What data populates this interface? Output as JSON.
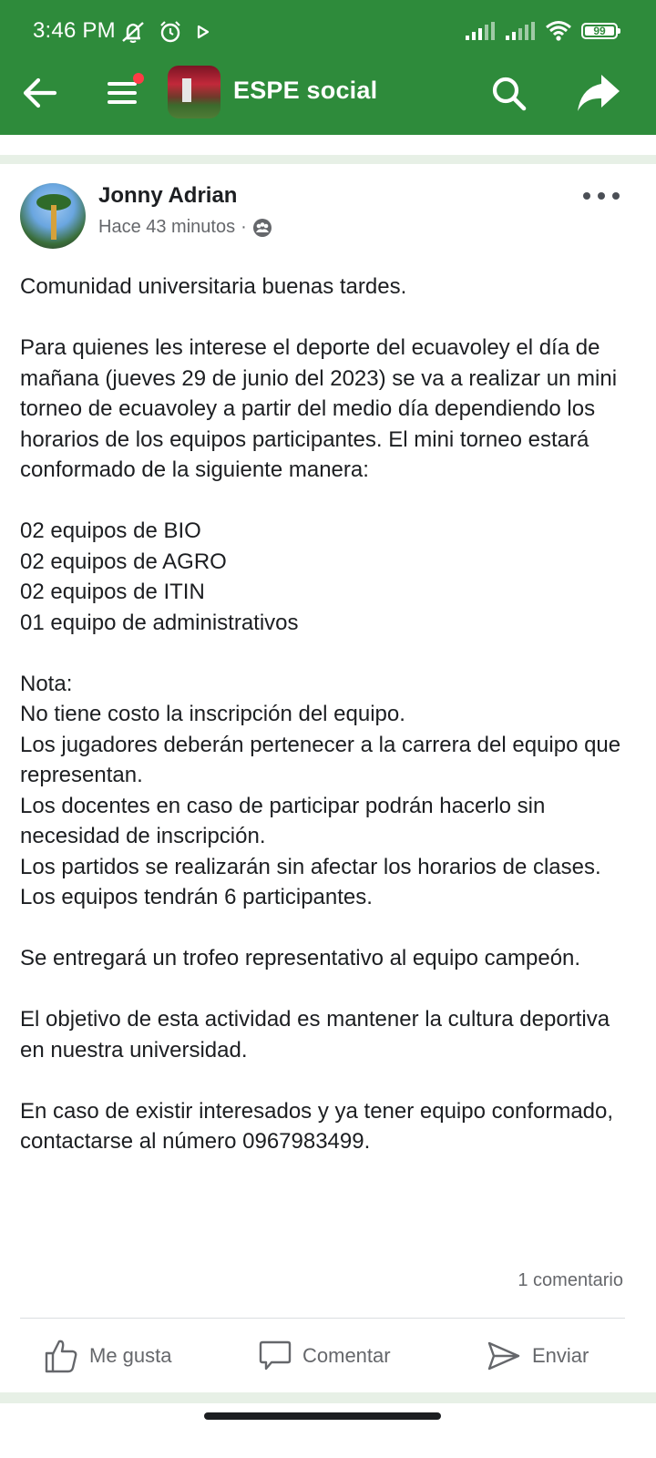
{
  "status_bar": {
    "time": "3:46 PM",
    "battery": "99",
    "icons": [
      "mute-icon",
      "alarm-icon",
      "play-icon",
      "signal-icon",
      "signal-icon",
      "wifi-icon",
      "battery-icon"
    ]
  },
  "app_bar": {
    "group_name": "ESPE social",
    "colors": {
      "bar": "#2e8b3b",
      "notification_dot": "#ff3b46"
    },
    "icons": [
      "back-arrow-icon",
      "menu-icon",
      "search-icon",
      "share-icon"
    ]
  },
  "post": {
    "author": "Jonny Adrian",
    "time": "Hace 43 minutos",
    "time_separator": "·",
    "privacy_icon": "group-audience-icon",
    "paragraphs": [
      "Comunidad universitaria buenas tardes.",
      "Para quienes les interese el deporte del ecuavoley el día de mañana (jueves 29 de junio del 2023) se va a realizar un mini torneo de ecuavoley a partir del medio día dependiendo los horarios de los equipos participantes. El mini torneo estará conformado de la siguiente manera:",
      "02 equipos de BIO\n02 equipos de AGRO\n02 equipos de ITIN\n01 equipo de administrativos",
      "Nota:\nNo tiene costo la inscripción del equipo.\nLos jugadores deberán pertenecer a la carrera del equipo que representan.\nLos docentes en caso de participar podrán hacerlo sin necesidad de inscripción.\nLos partidos se realizarán sin afectar los horarios de clases.\nLos equipos tendrán 6 participantes.",
      "Se entregará un trofeo representativo al equipo campeón.",
      "El objetivo de esta actividad es mantener la cultura deportiva en nuestra universidad.",
      "En caso de existir interesados y ya tener equipo conformado, contactarse al número 0967983499."
    ],
    "comment_count": "1 comentario",
    "actions": {
      "like": "Me gusta",
      "comment": "Comentar",
      "send": "Enviar"
    }
  }
}
